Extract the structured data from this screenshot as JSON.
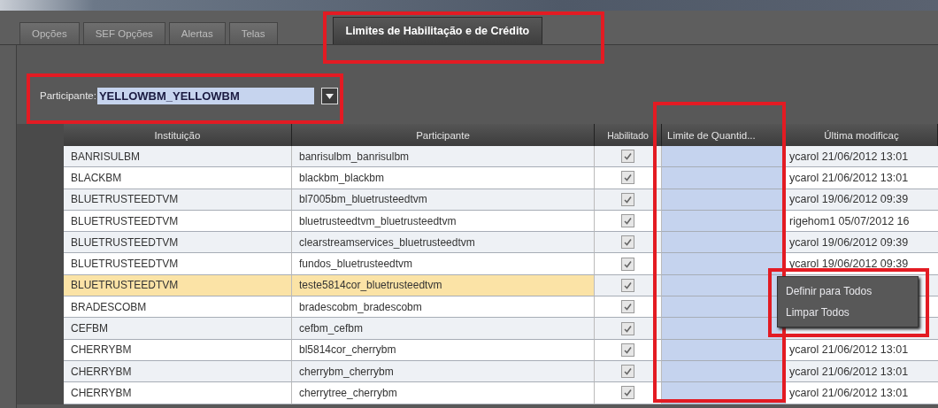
{
  "tabs": [
    {
      "label": "Opções",
      "selected": false
    },
    {
      "label": "SEF Opções",
      "selected": false
    },
    {
      "label": "Alertas",
      "selected": false
    },
    {
      "label": "Telas",
      "selected": false
    },
    {
      "label": "Limites de Habilitação e de Crédito",
      "selected": true
    }
  ],
  "participant_field": {
    "label": "Participante:",
    "value": "YELLOWBM_YELLOWBM"
  },
  "table": {
    "columns": [
      "Instituição",
      "Participante",
      "Habilitado",
      "Limite de Quantid...",
      "Última modificaç"
    ],
    "rows": [
      {
        "institution": "BANRISULBM",
        "participant": "banrisulbm_banrisulbm",
        "enabled": true,
        "modified": "ycarol  21/06/2012 13:01",
        "selected": false
      },
      {
        "institution": "BLACKBM",
        "participant": "blackbm_blackbm",
        "enabled": true,
        "modified": "ycarol  21/06/2012 13:01",
        "selected": false
      },
      {
        "institution": "BLUETRUSTEEDTVM",
        "participant": "bl7005bm_bluetrusteedtvm",
        "enabled": true,
        "modified": "ycarol  19/06/2012 09:39",
        "selected": false
      },
      {
        "institution": "BLUETRUSTEEDTVM",
        "participant": "bluetrusteedtvm_bluetrusteedtvm",
        "enabled": true,
        "modified": "rigehom1  05/07/2012 16",
        "selected": false
      },
      {
        "institution": "BLUETRUSTEEDTVM",
        "participant": "clearstreamservices_bluetrusteedtvm",
        "enabled": true,
        "modified": "ycarol  19/06/2012 09:39",
        "selected": false
      },
      {
        "institution": "BLUETRUSTEEDTVM",
        "participant": "fundos_bluetrusteedtvm",
        "enabled": true,
        "modified": "ycarol  19/06/2012 09:39",
        "selected": false
      },
      {
        "institution": "BLUETRUSTEEDTVM",
        "participant": "teste5814cor_bluetrusteedtvm",
        "enabled": true,
        "selected": true
      },
      {
        "institution": "BRADESCOBM",
        "participant": "bradescobm_bradescobm",
        "enabled": true,
        "selected": false
      },
      {
        "institution": "CEFBM",
        "participant": "cefbm_cefbm",
        "enabled": true,
        "selected": false
      },
      {
        "institution": "CHERRYBM",
        "participant": "bl5814cor_cherrybm",
        "enabled": true,
        "modified": "ycarol  21/06/2012 13:01",
        "selected": false
      },
      {
        "institution": "CHERRYBM",
        "participant": "cherrybm_cherrybm",
        "enabled": true,
        "modified": "ycarol  21/06/2012 13:01",
        "selected": false
      },
      {
        "institution": "CHERRYBM",
        "participant": "cherrytree_cherrybm",
        "enabled": true,
        "modified": "ycarol  21/06/2012 13:01",
        "selected": false
      }
    ]
  },
  "context_menu": {
    "items": [
      "Definir para Todos",
      "Limpar Todos"
    ]
  }
}
